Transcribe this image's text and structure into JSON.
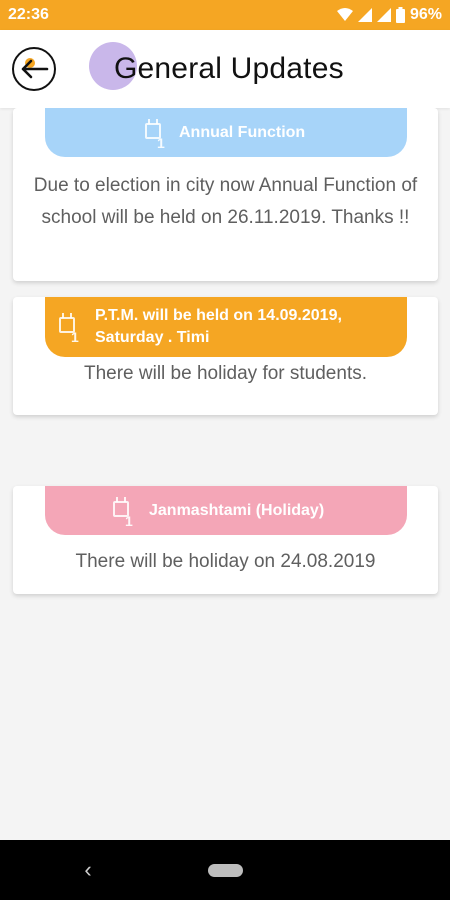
{
  "status_bar": {
    "time": "22:36",
    "battery": "96%",
    "icons": [
      "wifi-icon",
      "signal-icon",
      "signal-icon",
      "battery-icon"
    ]
  },
  "header": {
    "title": "General Updates",
    "back_icon": "arrow-left-icon"
  },
  "updates": [
    {
      "title": "Annual Function",
      "icon": "calendar-icon",
      "date_badge": "1",
      "color": "#a7d4f9",
      "body": "Due to election in city now Annual Function of school will be held on 26.11.2019. Thanks !!"
    },
    {
      "title": "P.T.M. will be held on 14.09.2019, Saturday . Timi",
      "icon": "calendar-icon",
      "date_badge": "1",
      "color": "#f5a623",
      "body": "There will be holiday for students."
    },
    {
      "title": "Janmashtami (Holiday)",
      "icon": "calendar-icon",
      "date_badge": "1",
      "color": "#f4a6b7",
      "body": "There will be holiday on 24.08.2019"
    }
  ],
  "nav": {
    "back_glyph": "‹",
    "home_icon": "home-pill-icon"
  }
}
